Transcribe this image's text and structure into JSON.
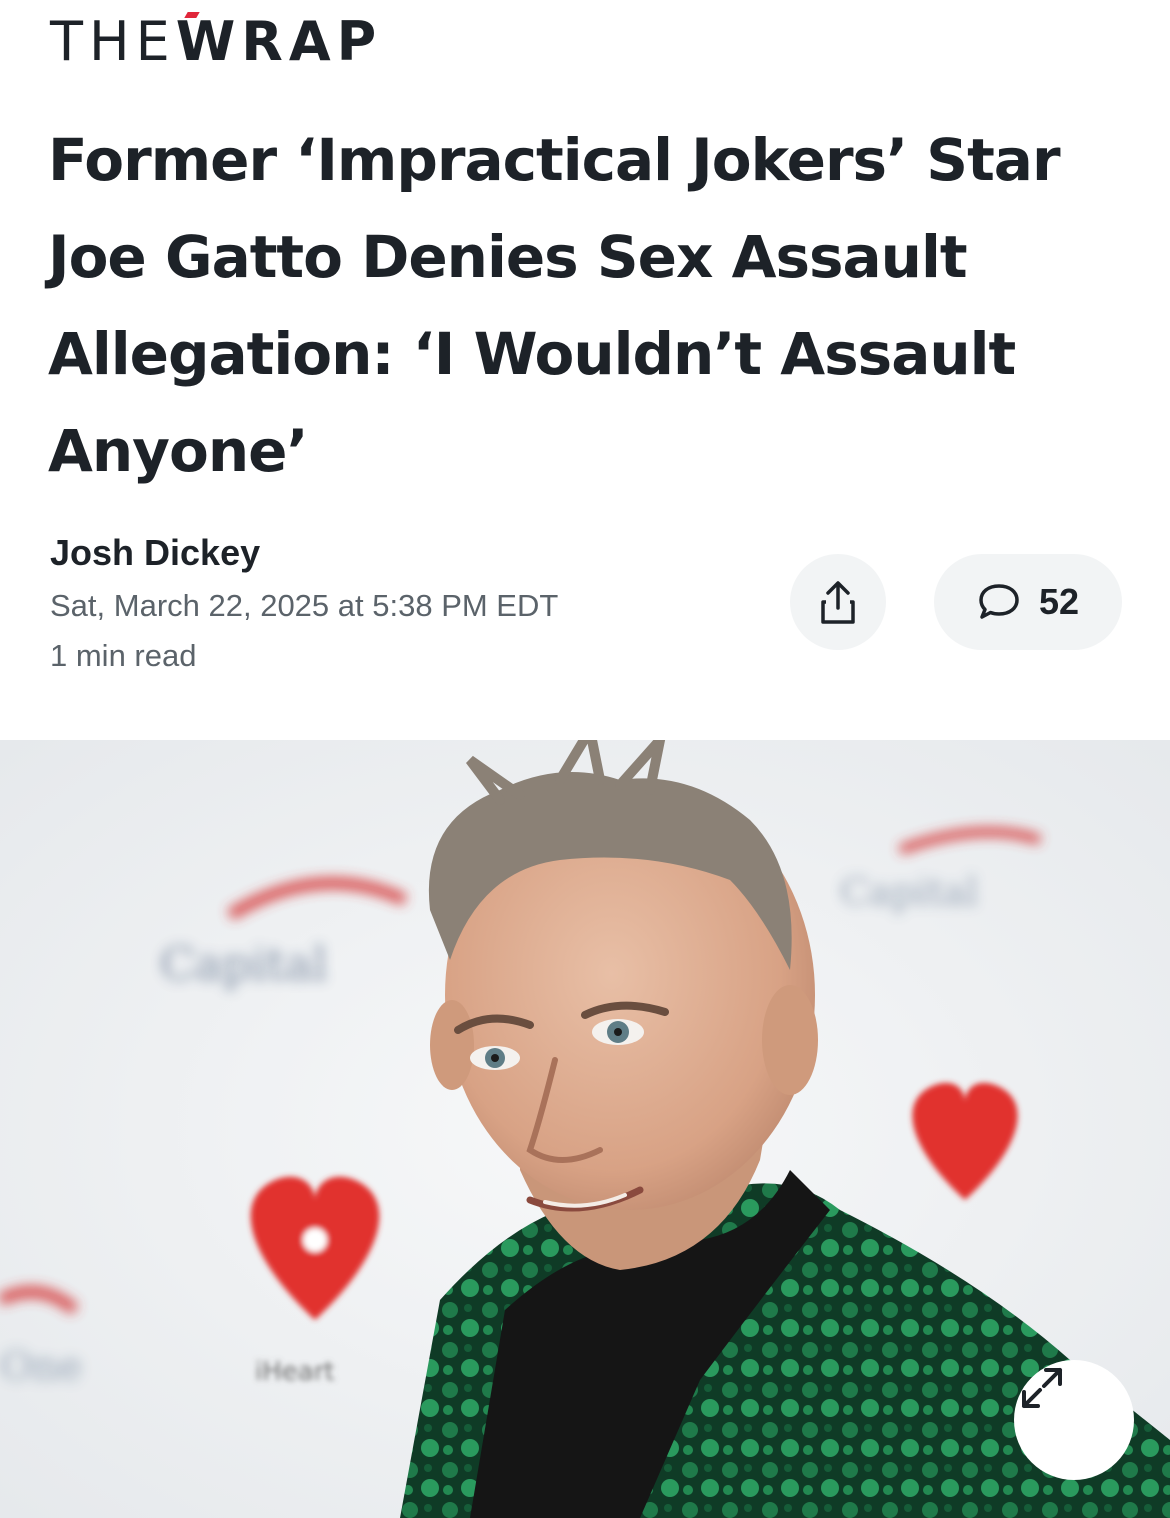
{
  "brand": {
    "part1": "THE",
    "part2": "WRAP"
  },
  "article": {
    "headline": "Former ‘Impractical Jokers’ Star Joe Gatto Denies Sex Assault Allegation: ‘I Wouldn’t Assault Anyone’",
    "author": "Josh Dickey",
    "date": "Sat, March 22, 2025 at 5:38 PM EDT",
    "read_time": "1 min read"
  },
  "actions": {
    "share_icon": "share-icon",
    "comments_icon": "comment-bubble-icon",
    "comments_count": "52"
  },
  "image": {
    "expand_icon": "expand-arrows-icon",
    "backdrop_logos": [
      "Capital One",
      "iHeart Radio"
    ]
  },
  "colors": {
    "brand_accent": "#e0263a",
    "text": "#1d2228",
    "muted_text": "#5b636a",
    "button_bg": "#f2f4f5",
    "jacket_green": "#1f7a4a"
  }
}
